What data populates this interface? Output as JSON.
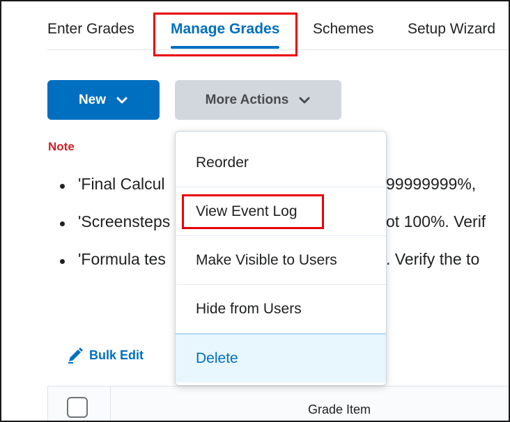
{
  "tabs": [
    {
      "label": "Enter Grades",
      "active": false
    },
    {
      "label": "Manage Grades",
      "active": true
    },
    {
      "label": "Schemes",
      "active": false
    },
    {
      "label": "Setup Wizard",
      "active": false
    }
  ],
  "toolbar": {
    "new_label": "New",
    "more_actions_label": "More Actions"
  },
  "note": {
    "label": "Note",
    "lines": [
      {
        "left": "'Final Calcul",
        "right": "99999999%,"
      },
      {
        "left": "'Screensteps",
        "right": "ot 100%. Verif"
      },
      {
        "left": "'Formula tes",
        "right": ". Verify the to"
      }
    ]
  },
  "bulk_edit": {
    "label": "Bulk Edit"
  },
  "table": {
    "header_grade_item": "Grade Item"
  },
  "more_actions_menu": {
    "items": [
      {
        "label": "Reorder"
      },
      {
        "label": "View Event Log"
      },
      {
        "label": "Make Visible to Users"
      },
      {
        "label": "Hide from Users"
      },
      {
        "label": "Delete"
      }
    ]
  },
  "colors": {
    "brand_blue": "#006fbf",
    "highlight_red": "#e8000b",
    "note_red": "#cd2026",
    "menu_selected_bg": "#e8f6fd"
  }
}
